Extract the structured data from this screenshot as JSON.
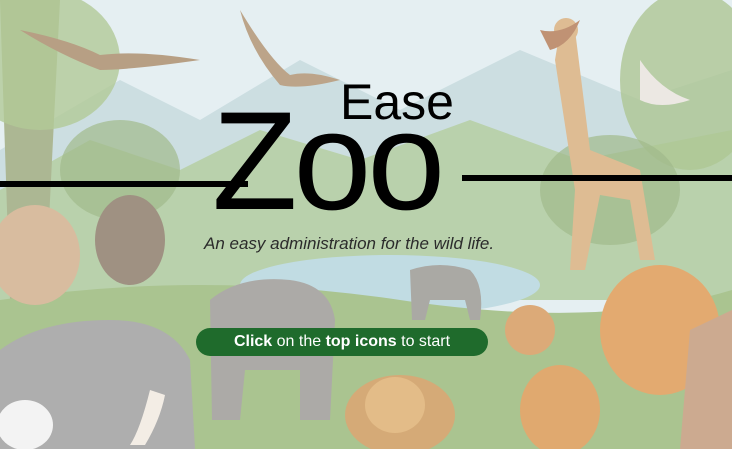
{
  "brand": {
    "small_word": "Ease",
    "big_word": "Zoo"
  },
  "tagline": "An easy administration for the wild life.",
  "start_hint": {
    "part1": "Click",
    "part2": " on the ",
    "part3": "top icons",
    "part4": " to start"
  },
  "colors": {
    "pill_background": "#1f6b2c",
    "text_dark": "#000000"
  },
  "background_image": "wildlife-jungle-illustration"
}
